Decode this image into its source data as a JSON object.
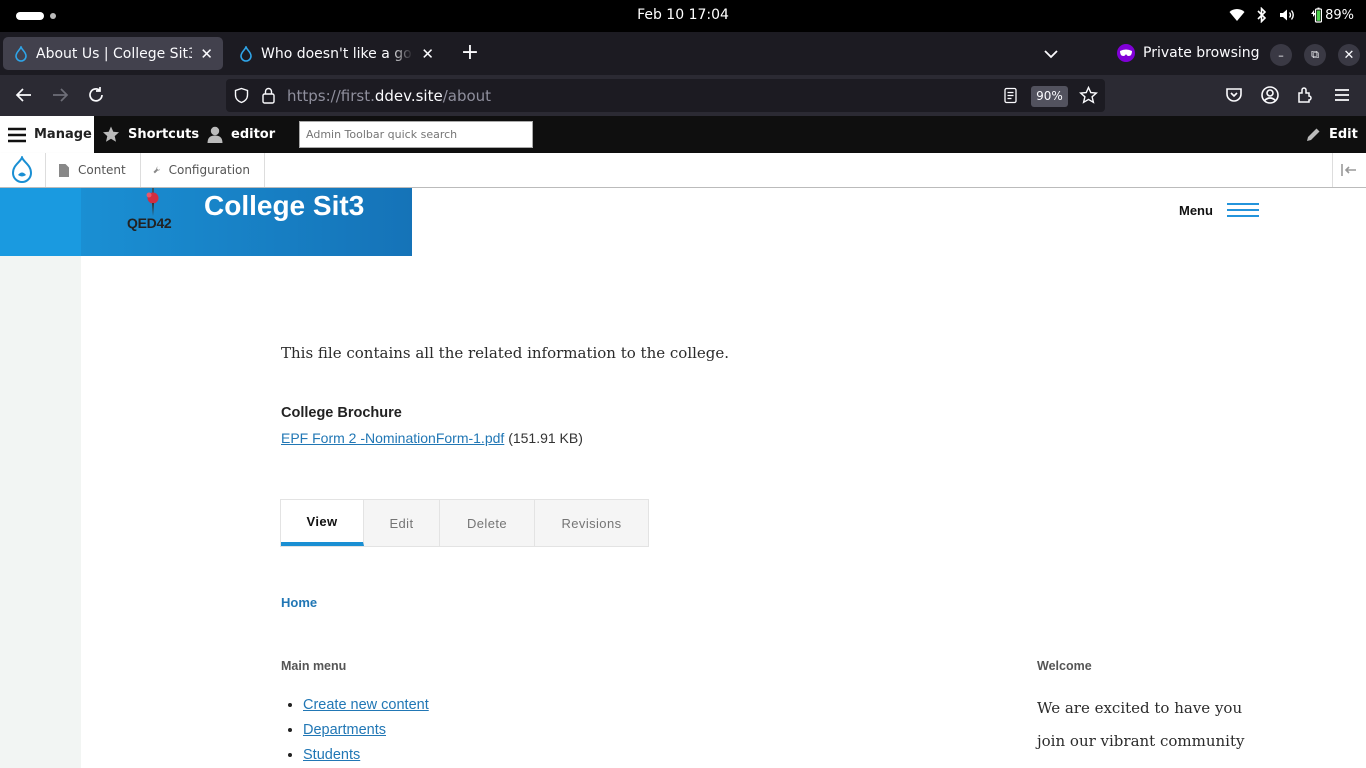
{
  "system": {
    "clock": "Feb 10  17:04",
    "battery": "89%"
  },
  "browser": {
    "tabs": [
      {
        "title": "About Us | College Sit3",
        "active": true
      },
      {
        "title": "Who doesn't like a good w",
        "active": false
      }
    ],
    "private_label": "Private browsing",
    "url": {
      "prefix": "https://first.",
      "domain": "ddev.site",
      "path": "/about"
    },
    "zoom": "90%"
  },
  "admin_toolbar": {
    "manage": "Manage",
    "shortcuts": "Shortcuts",
    "user": "editor",
    "search_placeholder": "Admin Toolbar quick search",
    "edit": "Edit",
    "tray": {
      "content": "Content",
      "configuration": "Configuration"
    }
  },
  "site": {
    "logo_text": "QED42",
    "name": "College Sit3",
    "menu_label": "Menu",
    "colors": {
      "brand_blue": "#1a8fd3",
      "link": "#2177b5"
    }
  },
  "content": {
    "body": "This file contains all the related information to the college.",
    "field_label": "College Brochure",
    "file_name": "EPF Form 2 -NominationForm-1.pdf",
    "file_size": "(151.91 KB)",
    "local_tabs": [
      "View",
      "Edit",
      "Delete",
      "Revisions"
    ],
    "breadcrumb": "Home"
  },
  "main_menu": {
    "title": "Main menu",
    "items": [
      "Create new content",
      "Departments",
      "Students"
    ]
  },
  "welcome_block": {
    "title": "Welcome",
    "lines": [
      "We are excited to have you",
      "join our vibrant community"
    ]
  }
}
